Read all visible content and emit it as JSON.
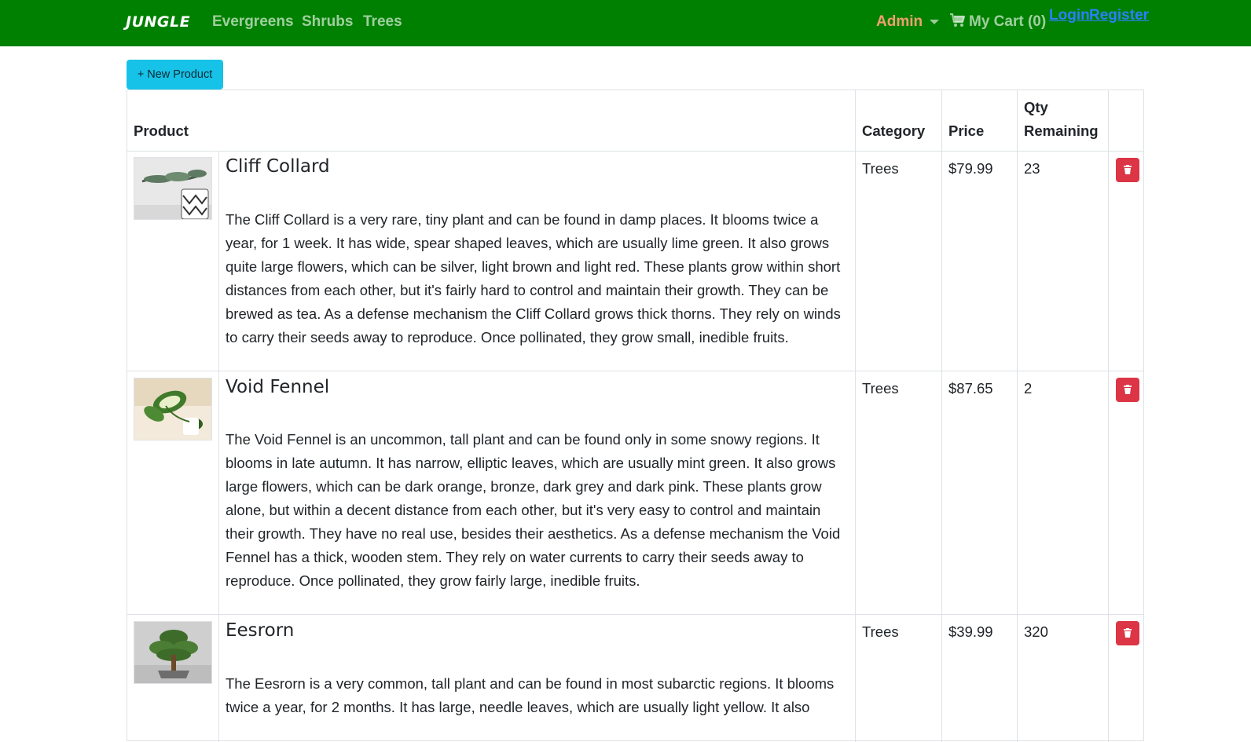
{
  "navbar": {
    "brand": "JUNGLE",
    "links": [
      "Evergreens",
      "Shrubs",
      "Trees"
    ],
    "admin": "Admin",
    "cart": "My Cart (0)",
    "login": "Login",
    "register": "Register"
  },
  "toolbar": {
    "new_product": "+ New Product"
  },
  "table": {
    "headers": {
      "product": "Product",
      "category": "Category",
      "price": "Price",
      "qty_line1": "Qty",
      "qty_line2": "Remaining"
    },
    "rows": [
      {
        "name": "Cliff Collard",
        "description": "The Cliff Collard is a very rare, tiny plant and can be found in damp places. It blooms twice a year, for 1 week. It has wide, spear shaped leaves, which are usually lime green. It also grows quite large flowers, which can be silver, light brown and light red. These plants grow within short distances from each other, but it's fairly hard to control and maintain their growth. They can be brewed as tea. As a defense mechanism the Cliff Collard grows thick thorns. They rely on winds to carry their seeds away to reproduce. Once pollinated, they grow small, inedible fruits.",
        "category": "Trees",
        "price": "$79.99",
        "qty": "23"
      },
      {
        "name": "Void Fennel",
        "description": "The Void Fennel is an uncommon, tall plant and can be found only in some snowy regions. It blooms in late autumn. It has narrow, elliptic leaves, which are usually mint green. It also grows large flowers, which can be dark orange, bronze, dark grey and dark pink. These plants grow alone, but within a decent distance from each other, but it's very easy to control and maintain their growth. They have no real use, besides their aesthetics. As a defense mechanism the Void Fennel has a thick, wooden stem. They rely on water currents to carry their seeds away to reproduce. Once pollinated, they grow fairly large, inedible fruits.",
        "category": "Trees",
        "price": "$87.65",
        "qty": "2"
      },
      {
        "name": "Eesrorn",
        "description": "The Eesrorn is a very common, tall plant and can be found in most subarctic regions. It blooms twice a year, for 2 months. It has large, needle leaves, which are usually light yellow. It also",
        "category": "Trees",
        "price": "$39.99",
        "qty": "320"
      }
    ]
  },
  "colors": {
    "navbar": "#008000",
    "info_button": "#17c2e8",
    "danger_button": "#dc3545",
    "link": "#2a7fff"
  }
}
